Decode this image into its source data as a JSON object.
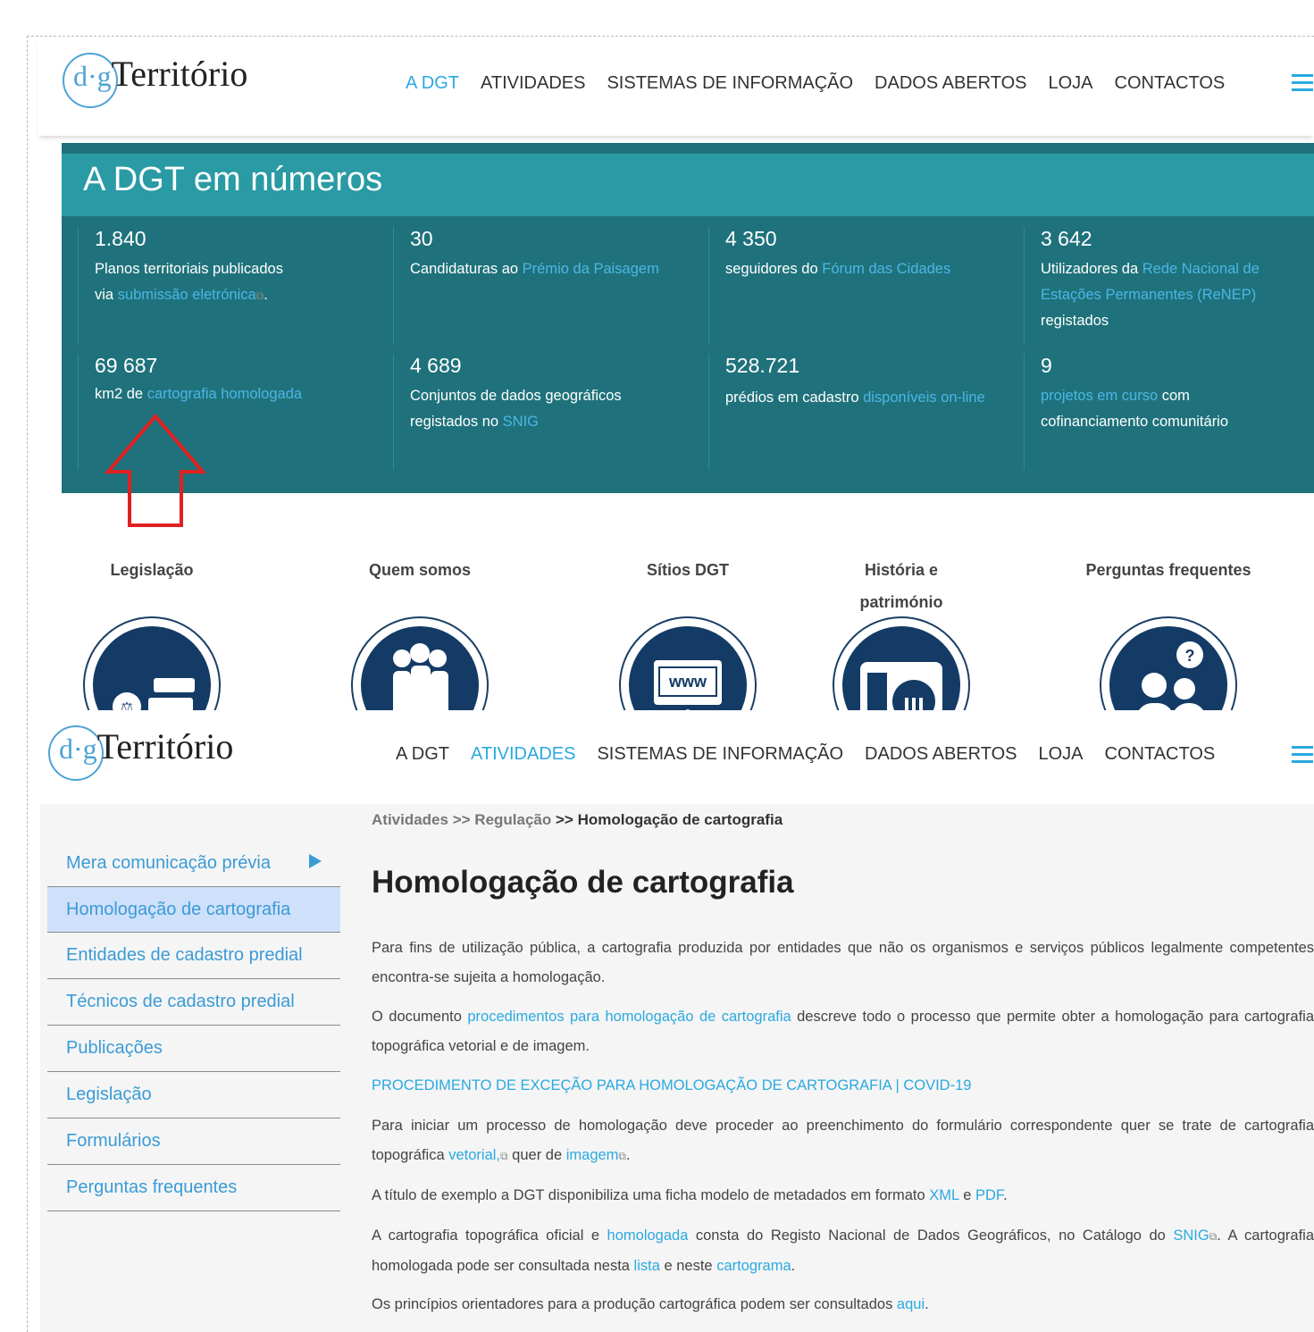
{
  "header1": {
    "logo_dg": "d·g",
    "logo_text": "Território",
    "nav": [
      "A DGT",
      "ATIVIDADES",
      "SISTEMAS DE INFORMAÇÃO",
      "DADOS ABERTOS",
      "LOJA",
      "CONTACTOS"
    ],
    "active": "A DGT"
  },
  "numbers": {
    "title": "A DGT em números",
    "row1": [
      {
        "num": "1.840",
        "pre": "Planos territoriais publicados",
        "line2_pre": "via ",
        "link": "submissão eletrónica",
        "post": "."
      },
      {
        "num": "30",
        "pre": "Candidaturas ao ",
        "link": "Prémio da Paisagem",
        "post": ""
      },
      {
        "num": "4 350",
        "pre": "seguidores do ",
        "link": "Fórum das Cidades",
        "post": ""
      },
      {
        "num": "3 642",
        "pre": "Utilizadores da ",
        "link": "Rede Nacional de Estações Permanentes (ReNEP)",
        "post": " registados"
      }
    ],
    "row2": [
      {
        "num": "69 687",
        "pre": "km2 de ",
        "link": "cartografia homologada",
        "post": ""
      },
      {
        "num": "4 689",
        "pre": "Conjuntos de dados geográficos registados no ",
        "link": "SNIG",
        "post": ""
      },
      {
        "num": "528.721",
        "pre": "prédios em cadastro ",
        "link": "disponíveis on-line",
        "post": ""
      },
      {
        "num": "9",
        "pre": "",
        "link": "projetos em curso",
        "post": " com cofinanciamento comunitário"
      }
    ]
  },
  "quicklinks": [
    "Legislação",
    "Quem somos",
    "Sítios DGT",
    "História e património",
    "Perguntas frequentes"
  ],
  "www_label": "www",
  "header2": {
    "logo_dg": "d·g",
    "logo_text": "Território",
    "nav": [
      "A DGT",
      "ATIVIDADES",
      "SISTEMAS DE INFORMAÇÃO",
      "DADOS ABERTOS",
      "LOJA",
      "CONTACTOS"
    ],
    "active": "ATIVIDADES"
  },
  "breadcrumb": {
    "a": "Atividades",
    "sep1": " >> ",
    "b": "Regulação",
    "sep2": "  >> ",
    "c": "Homologação de cartografia"
  },
  "sidebar": [
    "Mera comunicação prévia",
    "Homologação de cartografia",
    "Entidades de cadastro predial",
    "Técnicos de cadastro predial",
    "Publicações",
    "Legislação",
    "Formulários",
    "Perguntas frequentes"
  ],
  "page_title": "Homologação de cartografia",
  "content": {
    "p1": "Para fins de utilização pública, a cartografia produzida por entidades que não os organismos e serviços públicos legalmente competentes encontra-se sujeita a homologação.",
    "p2_pre": "O documento ",
    "p2_link": "procedimentos para homologação de cartografia",
    "p2_post": " descreve todo o processo que permite obter a homologação para cartografia topográfica vetorial e de imagem.",
    "p3_link": "PROCEDIMENTO DE EXCEÇÃO PARA HOMOLOGAÇÃO DE CARTOGRAFIA | COVID-19",
    "p4_pre": "Para iniciar um processo de homologação deve proceder ao preenchimento do formulário correspondente quer se trate de cartografia topográfica ",
    "p4_link1": "vetorial,",
    "p4_mid": " quer de ",
    "p4_link2": "imagem",
    "p4_post": ".",
    "p5_pre": "A título de exemplo a DGT disponibiliza uma ficha modelo de metadados em formato ",
    "p5_link1": "XML",
    "p5_mid": " e ",
    "p5_link2": "PDF",
    "p5_post": ".",
    "p6_pre": "A cartografia topográfica oficial e ",
    "p6_link1": "homologada",
    "p6_mid1": " consta do Registo Nacional de Dados Geográficos, no Catálogo do ",
    "p6_link2": "SNIG",
    "p6_mid2": ". A cartografia homologada pode ser consultada nesta ",
    "p6_link3": "lista",
    "p6_mid3": " e neste ",
    "p6_link4": "cartograma",
    "p6_post": ".",
    "p7_pre": "Os princípios orientadores para a produção cartográfica podem ser consultados ",
    "p7_link": "aqui",
    "p7_post": "."
  },
  "colors": {
    "panel": "#1f727b",
    "panel_title": "#2a9aa4",
    "link": "#2aa9e0",
    "arrow": "#e02020",
    "icon": "#143b66"
  }
}
